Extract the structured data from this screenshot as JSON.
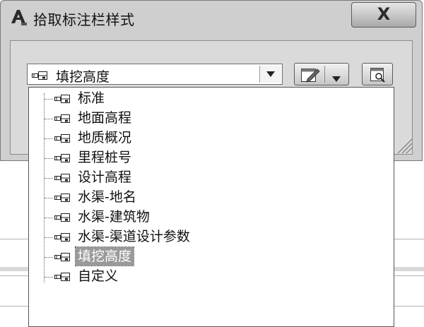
{
  "window": {
    "title": "拾取标注栏样式",
    "close_glyph": "X"
  },
  "combo": {
    "value": "填挖高度"
  },
  "dropdown": {
    "items": [
      {
        "label": "标准",
        "selected": false
      },
      {
        "label": "地面高程",
        "selected": false
      },
      {
        "label": "地质概况",
        "selected": false
      },
      {
        "label": "里程桩号",
        "selected": false
      },
      {
        "label": "设计高程",
        "selected": false
      },
      {
        "label": "水渠-地名",
        "selected": false
      },
      {
        "label": "水渠-建筑物",
        "selected": false
      },
      {
        "label": "水渠-渠道设计参数",
        "selected": false
      },
      {
        "label": "填挖高度",
        "selected": true
      },
      {
        "label": "自定义",
        "selected": false
      }
    ]
  },
  "icons": {
    "app": "autocad-app-icon",
    "close": "close-icon",
    "style_item": "band-style-icon",
    "dropdown_arrow": "chevron-down-icon",
    "edit": "edit-style-icon",
    "preview": "preview-zoom-icon",
    "resize": "resize-grip-icon"
  },
  "colors": {
    "selection": "#9a9a9a",
    "dialog_bg": "#cfcfcf"
  }
}
